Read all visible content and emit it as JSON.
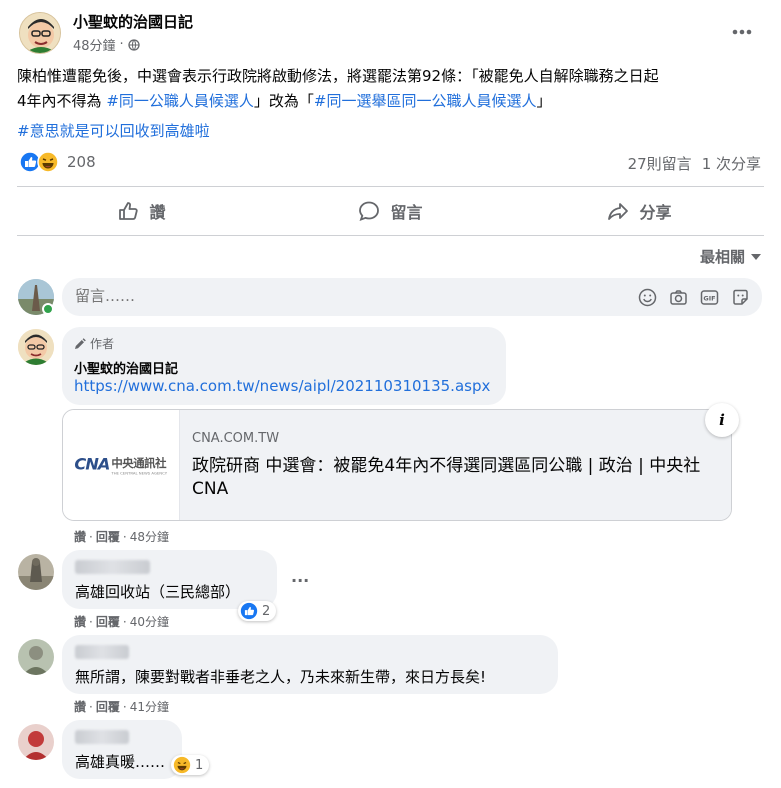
{
  "post": {
    "page_name": "小聖蚊的治國日記",
    "time": "48分鐘",
    "privacy_separator": "·",
    "text_line1": "陳柏惟遭罷免後，中選會表示行政院將啟動修法，將選罷法第92條：「被罷免人自解除職務之日起",
    "text_line2_a": "4年內不得為",
    "hashtag1": "#同一公職人員候選人",
    "text_line2_b": "」改為「",
    "hashtag2": "#同一選舉區同一公職人員候選人",
    "text_line2_c": "」",
    "hashtag3": "#意思就是可以回收到高雄啦",
    "more_icon": "ellipsis-icon"
  },
  "stats": {
    "reaction_count": "208",
    "comments": "27則留言",
    "shares": "1 次分享",
    "reaction_icons": [
      "like-icon",
      "haha-icon"
    ]
  },
  "actions": {
    "like": "讚",
    "comment": "留言",
    "share": "分享"
  },
  "sort": {
    "label": "最相關"
  },
  "composer": {
    "placeholder": "留言……",
    "icons": [
      "emoji-icon",
      "camera-icon",
      "gif-icon",
      "sticker-icon"
    ]
  },
  "comments": [
    {
      "author_badge": "作者",
      "author": "小聖蚊的治國日記",
      "link": "https://www.cna.com.tw/news/aipl/202110310135.aspx",
      "preview": {
        "logo_text": "中央通訊社",
        "logo_sub": "THE CENTRAL NEWS AGENCY",
        "logo_mark": "CNA",
        "domain": "CNA.COM.TW",
        "title": "政院研商 中選會：被罷免4年內不得選同選區同公職 | 政治 | 中央社 CNA",
        "info": "i"
      },
      "like": "讚",
      "reply": "回覆",
      "time": "48分鐘"
    },
    {
      "text": "高雄回收站（三民總部）",
      "like": "讚",
      "reply": "回覆",
      "time": "40分鐘",
      "reaction_count": "2",
      "more": "···"
    },
    {
      "text": "無所謂，陳要對戰者非垂老之人，乃未來新生帶，來日方長矣!",
      "like": "讚",
      "reply": "回覆",
      "time": "41分鐘"
    },
    {
      "text": "高雄真暖……",
      "reaction_count": "1"
    }
  ],
  "colors": {
    "link": "#216fdb",
    "meta_gray": "#65676b",
    "bubble": "#f0f2f5",
    "like_blue": "#1877f2",
    "online_green": "#31a24c"
  }
}
